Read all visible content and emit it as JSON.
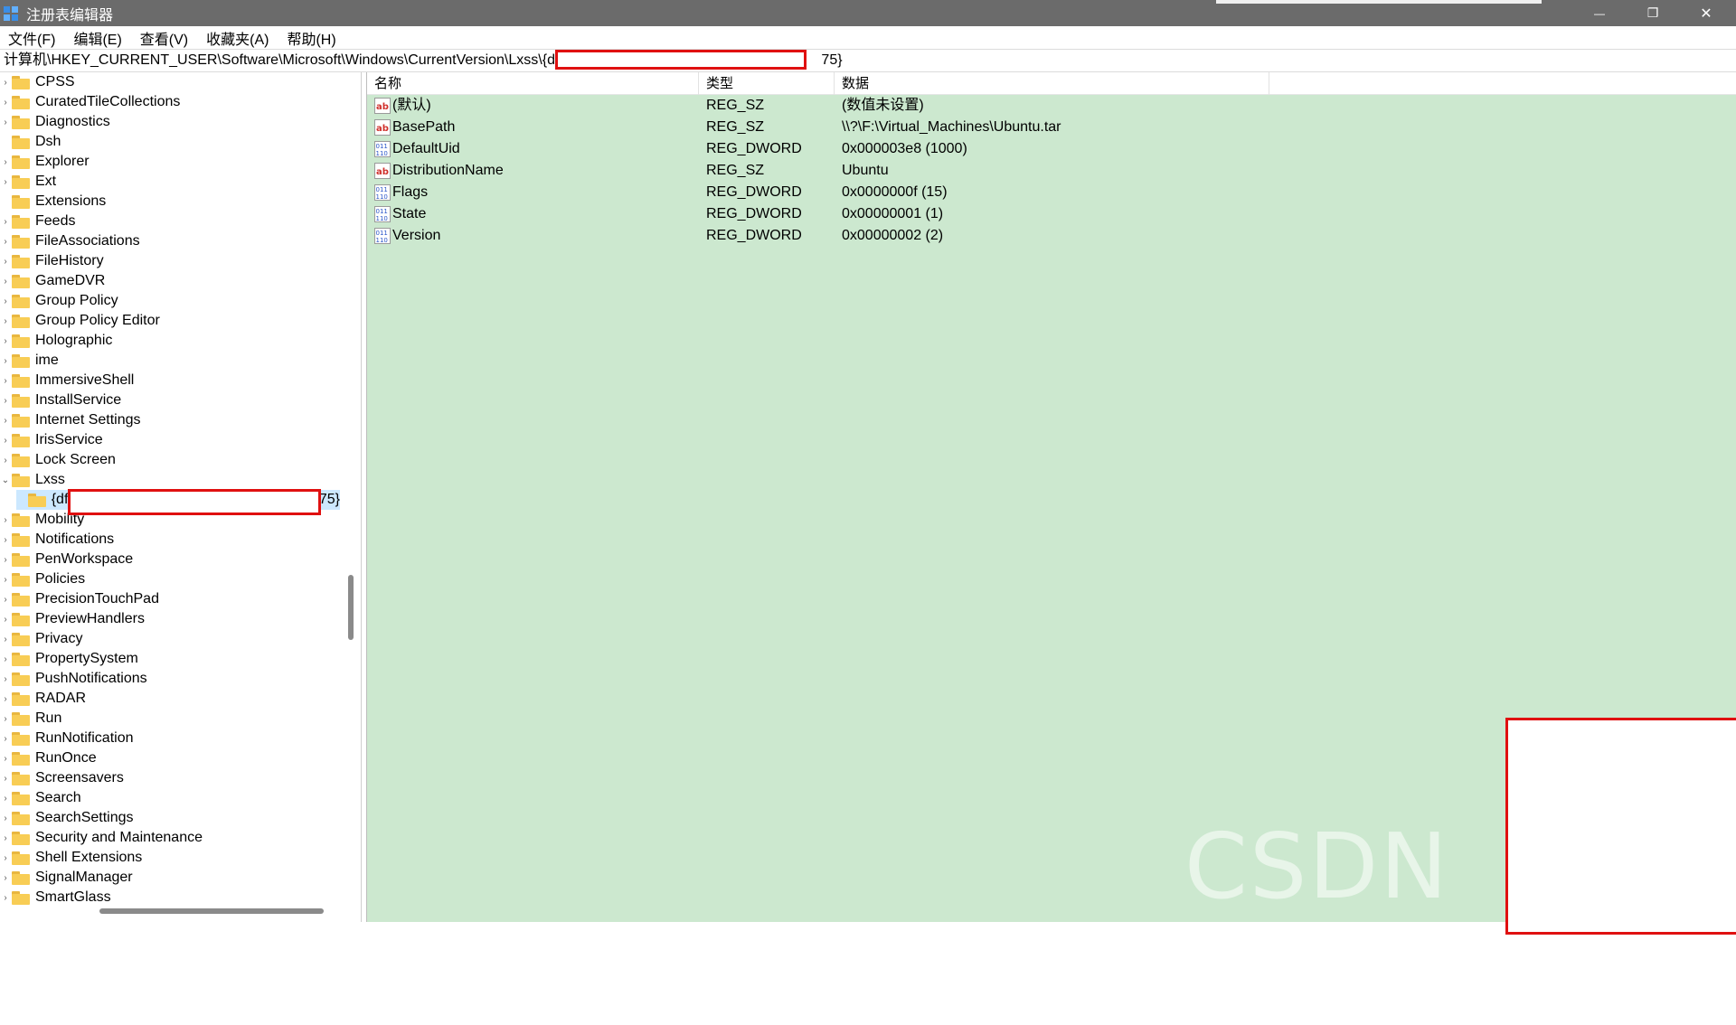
{
  "window": {
    "title": "注册表编辑器",
    "minimize_glyph": "—",
    "maximize_glyph": "❐",
    "close_glyph": "✕"
  },
  "menu": {
    "items": [
      "文件(F)",
      "编辑(E)",
      "查看(V)",
      "收藏夹(A)",
      "帮助(H)"
    ]
  },
  "address": {
    "prefix": "计算机\\HKEY_CURRENT_USER\\Software\\Microsoft\\Windows\\CurrentVersion\\Lxss\\{df",
    "suffix": "75}"
  },
  "tree": {
    "items": [
      {
        "label": "CPSS",
        "expander": "›"
      },
      {
        "label": "CuratedTileCollections",
        "expander": "›"
      },
      {
        "label": "Diagnostics",
        "expander": "›"
      },
      {
        "label": "Dsh",
        "expander": ""
      },
      {
        "label": "Explorer",
        "expander": "›"
      },
      {
        "label": "Ext",
        "expander": "›"
      },
      {
        "label": "Extensions",
        "expander": ""
      },
      {
        "label": "Feeds",
        "expander": "›"
      },
      {
        "label": "FileAssociations",
        "expander": "›"
      },
      {
        "label": "FileHistory",
        "expander": "›"
      },
      {
        "label": "GameDVR",
        "expander": "›"
      },
      {
        "label": "Group Policy",
        "expander": "›"
      },
      {
        "label": "Group Policy Editor",
        "expander": "›"
      },
      {
        "label": "Holographic",
        "expander": "›"
      },
      {
        "label": "ime",
        "expander": "›"
      },
      {
        "label": "ImmersiveShell",
        "expander": "›"
      },
      {
        "label": "InstallService",
        "expander": "›"
      },
      {
        "label": "Internet Settings",
        "expander": "›"
      },
      {
        "label": "IrisService",
        "expander": "›"
      },
      {
        "label": "Lock Screen",
        "expander": "›"
      },
      {
        "label": "Lxss",
        "expander": "⌄"
      },
      {
        "label": "{df",
        "expander": "",
        "child": true,
        "suffix": "75}"
      },
      {
        "label": "Mobility",
        "expander": "›"
      },
      {
        "label": "Notifications",
        "expander": "›"
      },
      {
        "label": "PenWorkspace",
        "expander": "›"
      },
      {
        "label": "Policies",
        "expander": "›"
      },
      {
        "label": "PrecisionTouchPad",
        "expander": "›"
      },
      {
        "label": "PreviewHandlers",
        "expander": "›"
      },
      {
        "label": "Privacy",
        "expander": "›"
      },
      {
        "label": "PropertySystem",
        "expander": "›"
      },
      {
        "label": "PushNotifications",
        "expander": "›"
      },
      {
        "label": "RADAR",
        "expander": "›"
      },
      {
        "label": "Run",
        "expander": "›"
      },
      {
        "label": "RunNotification",
        "expander": "›"
      },
      {
        "label": "RunOnce",
        "expander": "›"
      },
      {
        "label": "Screensavers",
        "expander": "›"
      },
      {
        "label": "Search",
        "expander": "›"
      },
      {
        "label": "SearchSettings",
        "expander": "›"
      },
      {
        "label": "Security and Maintenance",
        "expander": "›"
      },
      {
        "label": "Shell Extensions",
        "expander": "›"
      },
      {
        "label": "SignalManager",
        "expander": "›"
      },
      {
        "label": "SmartGlass",
        "expander": "›"
      }
    ]
  },
  "values_pane": {
    "columns": [
      "名称",
      "类型",
      "数据"
    ],
    "rows": [
      {
        "name": "(默认)",
        "type": "REG_SZ",
        "data": "(数值未设置)",
        "icon": "string-value-icon"
      },
      {
        "name": "BasePath",
        "type": "REG_SZ",
        "data": "\\\\?\\F:\\Virtual_Machines\\Ubuntu.tar",
        "icon": "string-value-icon"
      },
      {
        "name": "DefaultUid",
        "type": "REG_DWORD",
        "data": "0x000003e8 (1000)",
        "icon": "binary-value-icon"
      },
      {
        "name": "DistributionName",
        "type": "REG_SZ",
        "data": "Ubuntu",
        "icon": "string-value-icon"
      },
      {
        "name": "Flags",
        "type": "REG_DWORD",
        "data": "0x0000000f (15)",
        "icon": "binary-value-icon"
      },
      {
        "name": "State",
        "type": "REG_DWORD",
        "data": "0x00000001 (1)",
        "icon": "binary-value-icon"
      },
      {
        "name": "Version",
        "type": "REG_DWORD",
        "data": "0x00000002 (2)",
        "icon": "binary-value-icon"
      }
    ]
  },
  "watermark": "CSDN @Ayka",
  "colors": {
    "titlebar": "#6b6b6b",
    "values_background": "#cce8cf",
    "selection": "#cce8ff",
    "redaction_border": "#e01010",
    "folder": "#f8cd55"
  }
}
